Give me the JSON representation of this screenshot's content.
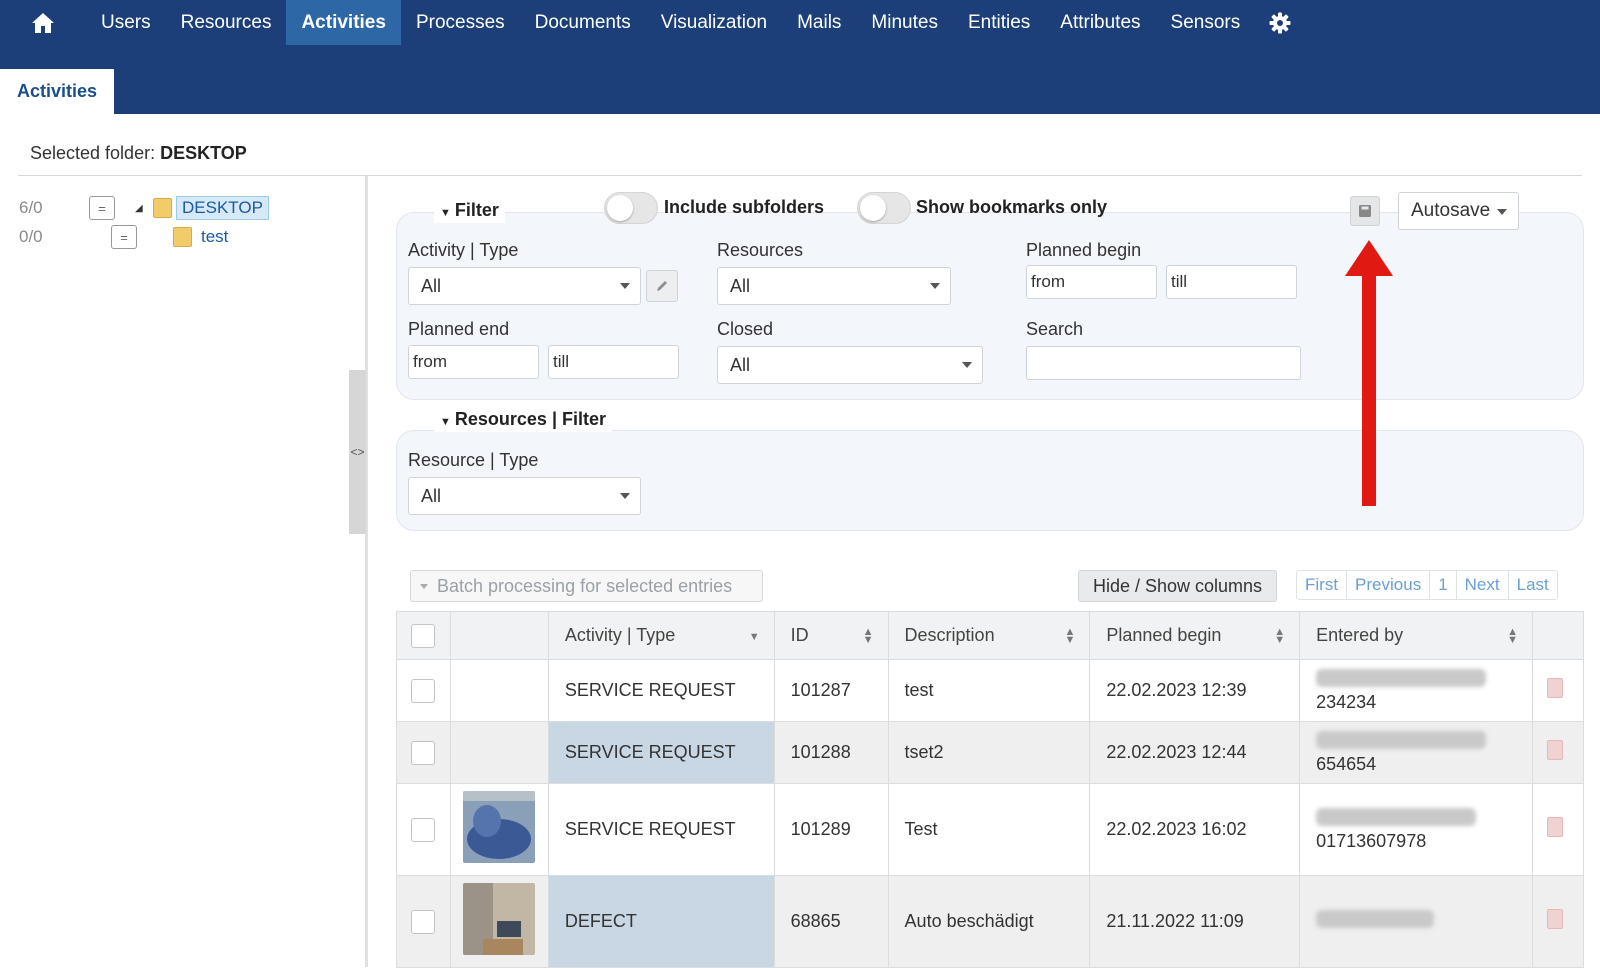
{
  "nav": {
    "items": [
      "Users",
      "Resources",
      "Activities",
      "Processes",
      "Documents",
      "Visualization",
      "Mails",
      "Minutes",
      "Entities",
      "Attributes",
      "Sensors"
    ],
    "active": "Activities"
  },
  "subtab": "Activities",
  "selected_folder": {
    "label": "Selected folder:",
    "value": "DESKTOP"
  },
  "tree": [
    {
      "count": "6/0",
      "name": "DESKTOP"
    },
    {
      "count": "0/0",
      "name": "test"
    }
  ],
  "filter": {
    "title": "Filter",
    "include_subfolders": "Include subfolders",
    "show_bookmarks": "Show bookmarks only",
    "autosave": "Autosave",
    "activity_type_label": "Activity | Type",
    "activity_type_value": "All",
    "resources_label": "Resources",
    "resources_value": "All",
    "planned_begin_label": "Planned begin",
    "planned_begin_from": "from",
    "planned_begin_till": "till",
    "planned_end_label": "Planned end",
    "planned_end_from": "from",
    "planned_end_till": "till",
    "closed_label": "Closed",
    "closed_value": "All",
    "search_label": "Search"
  },
  "resources_filter": {
    "title": "Resources | Filter",
    "resource_type_label": "Resource | Type",
    "resource_type_value": "All"
  },
  "toolbar": {
    "batch": "Batch processing for selected entries",
    "hide_show": "Hide / Show columns",
    "pager": [
      "First",
      "Previous",
      "1",
      "Next",
      "Last"
    ]
  },
  "table": {
    "columns": [
      "Activity | Type",
      "ID",
      "Description",
      "Planned begin",
      "Entered by"
    ],
    "rows": [
      {
        "type": "SERVICE REQUEST",
        "id": "101287",
        "description": "test",
        "planned_begin": "22.02.2023 12:39",
        "entered_by": "234234"
      },
      {
        "type": "SERVICE REQUEST",
        "id": "101288",
        "description": "tset2",
        "planned_begin": "22.02.2023 12:44",
        "entered_by": "654654"
      },
      {
        "type": "SERVICE REQUEST",
        "id": "101289",
        "description": "Test",
        "planned_begin": "22.02.2023 16:02",
        "entered_by": "01713607978"
      },
      {
        "type": "DEFECT",
        "id": "68865",
        "description": "Auto beschädigt",
        "planned_begin": "21.11.2022 11:09",
        "entered_by": ""
      }
    ]
  },
  "colors": {
    "nav_bg": "#1c3f7a",
    "nav_active": "#2d67a6",
    "annotation_arrow": "#e01a12"
  }
}
